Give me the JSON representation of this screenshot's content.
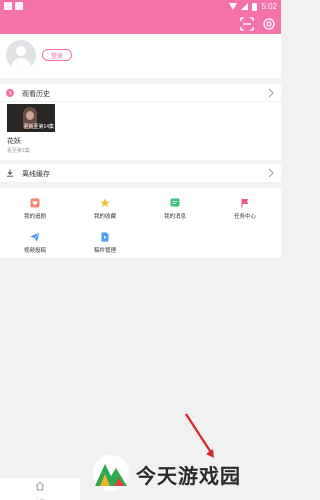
{
  "status_bar": {
    "time": "5:02"
  },
  "user": {
    "login_label": "登录"
  },
  "history": {
    "title": "观看历史",
    "items": [
      {
        "badge": "更新至第14集",
        "title": "花妖",
        "subtitle": "看至第1集"
      }
    ]
  },
  "offline": {
    "title": "离线缓存"
  },
  "grid": {
    "items": [
      {
        "label": "我的追剧",
        "icon": "heart-tag-icon",
        "color": "#f5856f"
      },
      {
        "label": "我的收藏",
        "icon": "star-icon",
        "color": "#f5c02a"
      },
      {
        "label": "我的消息",
        "icon": "message-icon",
        "color": "#3ec17a"
      },
      {
        "label": "任务中心",
        "icon": "flag-icon",
        "color": "#f25a86"
      },
      {
        "label": "视频投稿",
        "icon": "paper-plane-icon",
        "color": "#3d8ef0"
      },
      {
        "label": "稿件管理",
        "icon": "video-file-icon",
        "color": "#4a9ef5"
      }
    ]
  },
  "tabbar": {
    "home_label": "首页"
  },
  "watermark": {
    "text": "今天游戏园"
  },
  "colors": {
    "brand_pink": "#f472a8",
    "background": "#f1f1f1"
  }
}
